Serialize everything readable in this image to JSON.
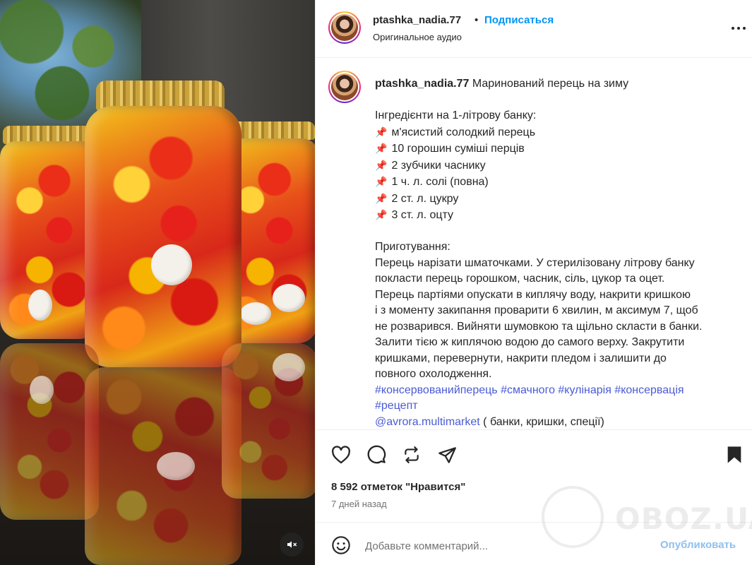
{
  "post": {
    "username": "ptashka_nadia.77",
    "separator": "•",
    "follow_label": "Подписаться",
    "audio_label": "Оригинальное аудио"
  },
  "caption": {
    "username": "ptashka_nadia.77",
    "title": "Маринований перець на зиму",
    "ingredients_heading": "Інгредієнти на 1-літрову банку:",
    "ingredients": [
      "м'ясистий солодкий перець",
      "10 горошин суміші перців",
      "2 зубчики часнику",
      "1 ч. л. солі (повна)",
      "2 ст. л. цукру",
      "3 ст. л. оцту"
    ],
    "method_heading": "Приготування:",
    "method_lines": [
      "Перець нарізати шматочками. У стерилізовану літрову банку",
      "покласти перець горошком, часник, сіль, цукор та оцет.",
      "Перець партіями опускати в киплячу воду, накрити кришкою",
      "і з моменту закипання проварити 6 хвилин, м аксимум 7, щоб",
      "не розварився. Вийняти шумовкою та щільно скласти в банки.",
      "Залити тією ж киплячою водою до самого верху. Закрутити",
      "кришками, перевернути, накрити пледом і залишити до",
      "повного охолодження."
    ],
    "hashtags_line1": "#консервованийперець #смачного #кулінарія #консервація",
    "hashtags_line2": "#рецепт",
    "mention": "@avrora.multimarket",
    "mention_suffix": " ( банки, кришки, спеції)"
  },
  "stats": {
    "likes": "8 592 отметок \"Нравится\"",
    "time_ago": "7 дней назад"
  },
  "comment": {
    "placeholder": "Добавьте комментарий...",
    "publish_label": "Опубликовать"
  },
  "watermark": {
    "text": "OBOZ.UA"
  },
  "icons": {
    "like": "heart-icon",
    "comment": "comment-icon",
    "share": "repost-icon",
    "send": "send-icon",
    "save": "bookmark-icon",
    "more": "more-icon",
    "emoji": "emoji-icon",
    "mute": "muted-speaker-icon"
  },
  "colors": {
    "accent": "#0095f6",
    "link": "#4b5bd6",
    "publish_disabled": "#8fbfed",
    "pin": "#e0245e"
  }
}
